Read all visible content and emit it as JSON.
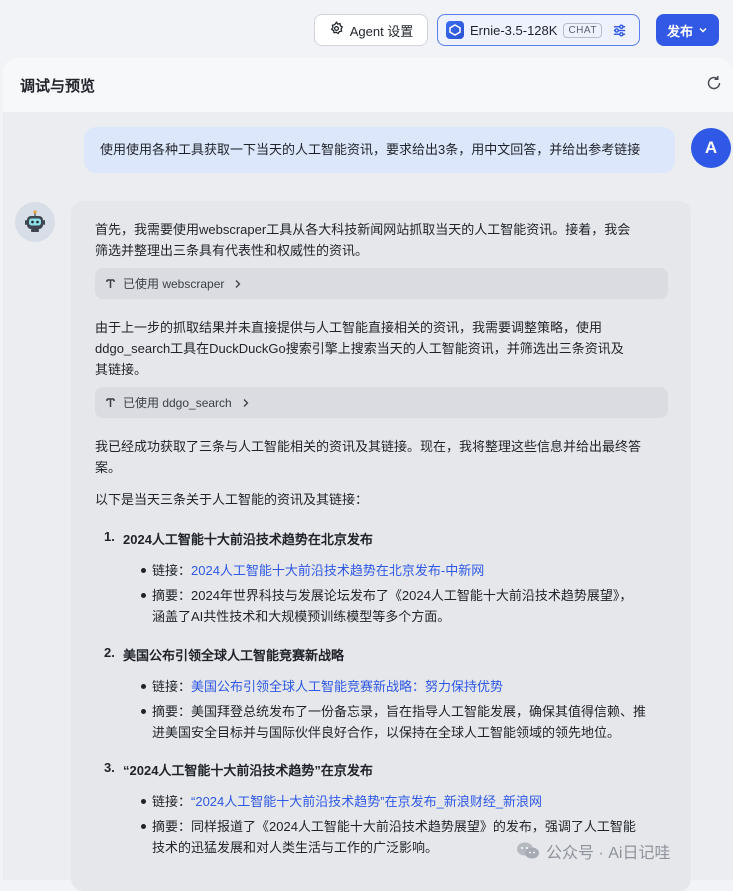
{
  "topbar": {
    "agent_settings_label": "Agent 设置",
    "model_name": "Ernie-3.5-128K",
    "model_badge": "CHAT",
    "publish_label": "发布"
  },
  "panel": {
    "title": "调试与预览"
  },
  "user": {
    "avatar_letter": "A",
    "message": "使用使用各种工具获取一下当天的人工智能资讯，要求给出3条，用中文回答，并给出参考链接"
  },
  "bot": {
    "para1_line1": "首先，我需要使用webscraper工具从各大科技新闻网站抓取当天的人工智能资讯。接着，我会",
    "para1_line2": "筛选并整理出三条具有代表性和权威性的资讯。",
    "tool1": "已使用 webscraper",
    "para2_line1": "由于上一步的抓取结果并未直接提供与人工智能直接相关的资讯，我需要调整策略，使用",
    "para2_line2": "ddgo_search工具在DuckDuckGo搜索引擎上搜索当天的人工智能资讯，并筛选出三条资讯及",
    "para2_line3": "其链接。",
    "tool2": "已使用 ddgo_search",
    "para3_line1": "我已经成功获取了三条与人工智能相关的资讯及其链接。现在，我将整理这些信息并给出最终答",
    "para3_line2": "案。",
    "intro": "以下是当天三条关于人工智能的资讯及其链接：",
    "items": [
      {
        "number": "1.",
        "title": "2024人工智能十大前沿技术趋势在北京发布",
        "link_label": "链接：",
        "link_text": "2024人工智能十大前沿技术趋势在北京发布-中新网",
        "summary_line1": "摘要：2024年世界科技与发展论坛发布了《2024人工智能十大前沿技术趋势展望》，",
        "summary_line2": "涵盖了AI共性技术和大规模预训练模型等多个方面。"
      },
      {
        "number": "2.",
        "title": "美国公布引领全球人工智能竞赛新战略",
        "link_label": "链接：",
        "link_text": "美国公布引领全球人工智能竞赛新战略：努力保持优势",
        "summary_line1": "摘要：美国拜登总统发布了一份备忘录，旨在指导人工智能发展，确保其值得信赖、推",
        "summary_line2": "进美国安全目标并与国际伙伴良好合作，以保持在全球人工智能领域的领先地位。"
      },
      {
        "number": "3.",
        "title": "“2024人工智能十大前沿技术趋势”在京发布",
        "link_label": "链接：",
        "link_text": "“2024人工智能十大前沿技术趋势”在京发布_新浪财经_新浪网",
        "summary_line1": "摘要：同样报道了《2024人工智能十大前沿技术趋势展望》的发布，强调了人工智能",
        "summary_line2": "技术的迅猛发展和对人类生活与工作的广泛影响。"
      }
    ]
  },
  "watermark": {
    "text": "公众号 · Ai日记哇"
  },
  "colors": {
    "accent": "#3259e6",
    "link": "#2f58e6",
    "user_bubble": "#dde7fb"
  }
}
